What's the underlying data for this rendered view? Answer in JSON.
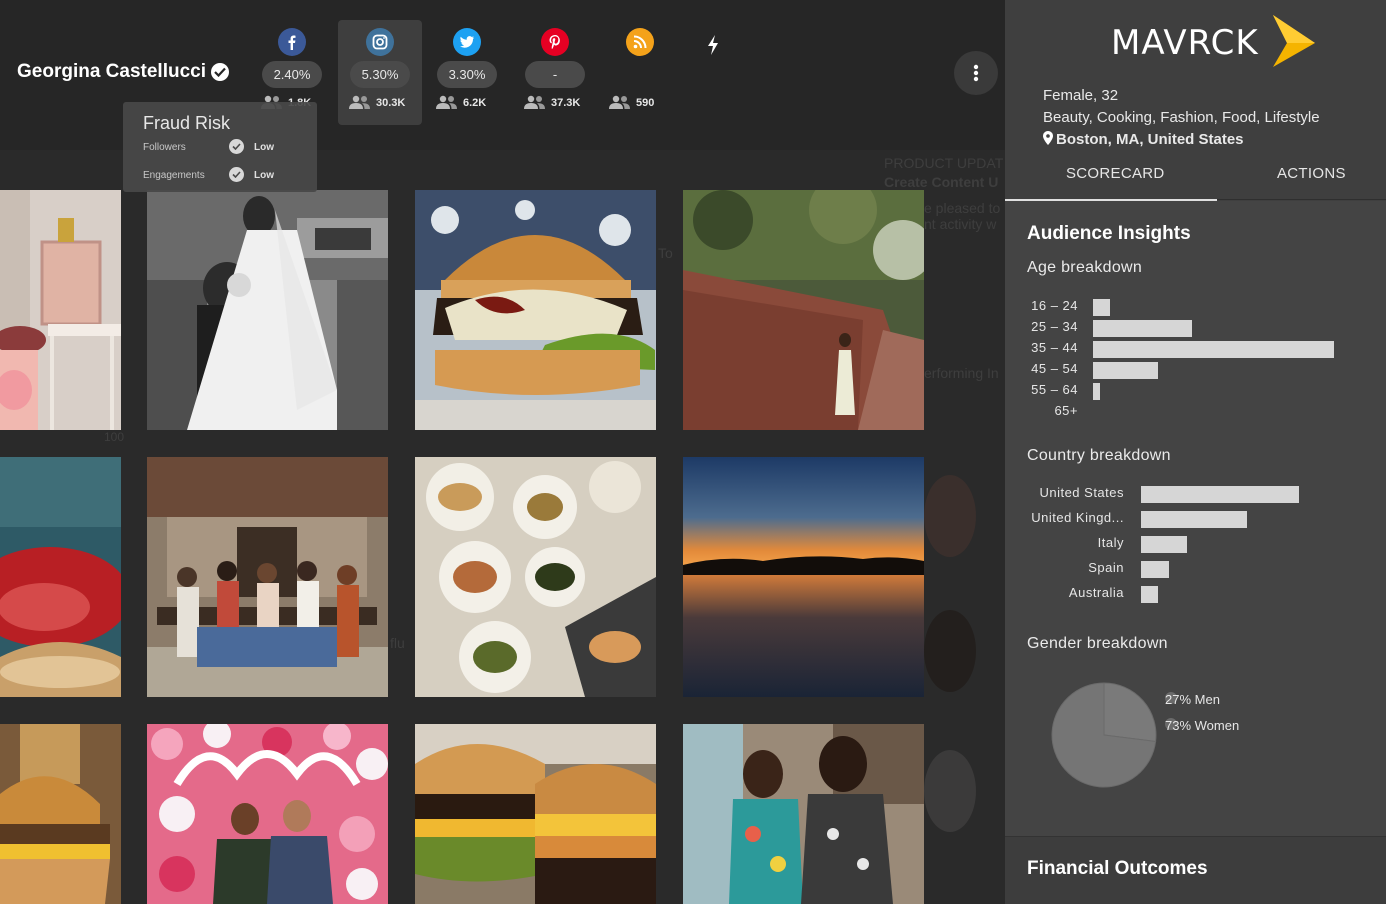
{
  "influencer": {
    "name": "Georgina Castellucci",
    "verified": true
  },
  "platforms": [
    {
      "network": "Facebook",
      "icon": "facebook-icon",
      "color": "#3b5998",
      "rate": "2.40%",
      "followers": "1.8K"
    },
    {
      "network": "Instagram",
      "icon": "instagram-icon",
      "color": "#3f729b",
      "rate": "5.30%",
      "followers": "30.3K",
      "active": true
    },
    {
      "network": "Twitter",
      "icon": "twitter-icon",
      "color": "#1da1f2",
      "rate": "3.30%",
      "followers": "6.2K"
    },
    {
      "network": "Pinterest",
      "icon": "pinterest-icon",
      "color": "#e60023",
      "rate": "-",
      "followers": "37.3K"
    },
    {
      "network": "Blog",
      "icon": "rss-icon",
      "color": "#f4a21a",
      "rate": "",
      "followers": "590"
    }
  ],
  "fraud_risk": {
    "title": "Fraud Risk",
    "rows": [
      {
        "label": "Followers",
        "value": "Low"
      },
      {
        "label": "Engagements",
        "value": "Low"
      }
    ]
  },
  "background_ghost": {
    "product_update": "PRODUCT UPDAT",
    "create_content": "Create Content U",
    "pleased": "e pleased to",
    "activity": "nt activity w",
    "performing": "erforming In",
    "hundred": "100",
    "to": "To",
    "flu": "flu"
  },
  "photos": [
    {
      "subject": "baby shower welcome sign"
    },
    {
      "subject": "wedding couple black and white"
    },
    {
      "subject": "burger close-up"
    },
    {
      "subject": "woman by brick wall"
    },
    {
      "subject": "pool float"
    },
    {
      "subject": "group of women on bench"
    },
    {
      "subject": "food plates overhead"
    },
    {
      "subject": "sunset over lake"
    },
    {
      "subject": "burgers"
    },
    {
      "subject": "Boston flower wall"
    },
    {
      "subject": "two burgers"
    },
    {
      "subject": "two women laughing"
    }
  ],
  "sidebar": {
    "brand": "MAVRCK",
    "profile": {
      "demographic": "Female, 32",
      "categories": "Beauty, Cooking, Fashion, Food, Lifestyle",
      "location": "Boston, MA, United States"
    },
    "tabs": [
      {
        "label": "SCORECARD",
        "active": true
      },
      {
        "label": "ACTIONS",
        "active": false
      }
    ],
    "audience_insights": {
      "title": "Audience Insights",
      "age": {
        "title": "Age breakdown",
        "bars": [
          {
            "label": "16 – 24",
            "value": 7
          },
          {
            "label": "25 – 34",
            "value": 41
          },
          {
            "label": "35 – 44",
            "value": 100
          },
          {
            "label": "45 – 54",
            "value": 27
          },
          {
            "label": "55 – 64",
            "value": 3
          },
          {
            "label": "65+",
            "value": 0
          }
        ]
      },
      "country": {
        "title": "Country breakdown",
        "bars": [
          {
            "label": "United States",
            "value": 100
          },
          {
            "label": "United Kingd...",
            "value": 67
          },
          {
            "label": "Italy",
            "value": 29
          },
          {
            "label": "Spain",
            "value": 18
          },
          {
            "label": "Australia",
            "value": 11
          }
        ]
      },
      "gender": {
        "title": "Gender breakdown",
        "slices": [
          {
            "label": "27% Men",
            "value": 27
          },
          {
            "label": "73% Women",
            "value": 73
          }
        ]
      }
    },
    "financial": {
      "title": "Financial Outcomes"
    }
  }
}
